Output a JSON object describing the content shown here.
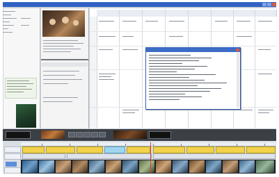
{
  "window": {
    "title": ""
  },
  "colors": {
    "titlebar": "#2f62c4",
    "dialog_border": "#3560b8",
    "timecode_text": "#f0a02a",
    "clip_yellow": "#f1d24a",
    "clip_blue": "#9fd6ef",
    "playhead": "#d63b2f"
  },
  "icons": [
    "minimize-icon",
    "maximize-icon",
    "close-icon",
    "play-icon",
    "stop-icon",
    "rewind-icon",
    "forward-icon"
  ],
  "dialog": {
    "title": ""
  },
  "timecodes": [
    "",
    ""
  ],
  "track_labels": [
    "",
    "",
    ""
  ],
  "table": {
    "column_headers": [
      "",
      "",
      "",
      "",
      "",
      "",
      "",
      ""
    ]
  },
  "mid_panel": {
    "header": ""
  }
}
